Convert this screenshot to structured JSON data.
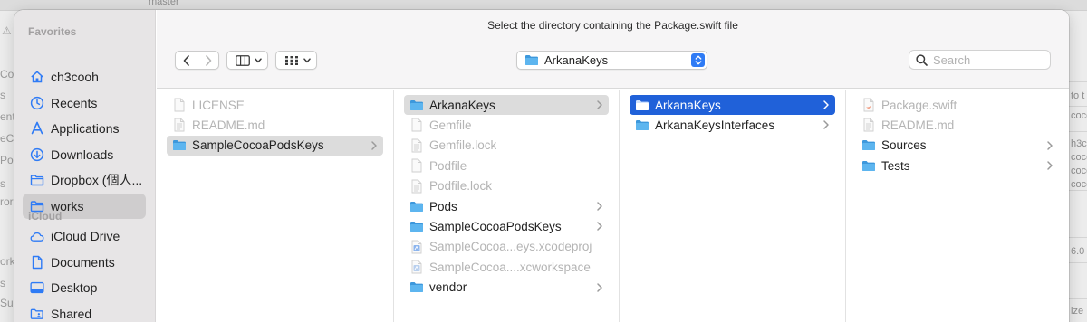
{
  "background": {
    "branch": "master",
    "left_fragments": [
      "Coc",
      "s",
      "entV",
      "eCo",
      "Po",
      "s",
      "rork",
      "ork",
      "s",
      "Sup"
    ],
    "right_fragments": [
      "to t",
      "coco",
      "h3co",
      "coco",
      "coco",
      "coco",
      "6.0",
      "ize"
    ]
  },
  "dialog": {
    "title": "Select the directory containing the Package.swift file",
    "current_directory": "ArkanaKeys",
    "search_placeholder": "Search"
  },
  "sidebar": {
    "favorites_title": "Favorites",
    "favorites": [
      {
        "label": "ch3cooh",
        "icon": "home-icon"
      },
      {
        "label": "Recents",
        "icon": "clock-icon"
      },
      {
        "label": "Applications",
        "icon": "applications-icon"
      },
      {
        "label": "Downloads",
        "icon": "download-icon"
      },
      {
        "label": "Dropbox (個人...",
        "icon": "folder-icon"
      },
      {
        "label": "works",
        "icon": "folder-icon",
        "selected": true
      }
    ],
    "icloud_title": "iCloud",
    "icloud": [
      {
        "label": "iCloud Drive",
        "icon": "cloud-icon"
      },
      {
        "label": "Documents",
        "icon": "document-icon"
      },
      {
        "label": "Desktop",
        "icon": "desktop-icon"
      },
      {
        "label": "Shared",
        "icon": "shared-folder-icon"
      }
    ]
  },
  "columns": [
    {
      "items": [
        {
          "label": "LICENSE",
          "type": "file",
          "dim": true
        },
        {
          "label": "README.md",
          "type": "doc",
          "dim": true
        },
        {
          "label": "SampleCocoaPodsKeys",
          "type": "folder",
          "state": "selected-gray",
          "chevron": true
        }
      ]
    },
    {
      "items": [
        {
          "label": "ArkanaKeys",
          "type": "folder",
          "state": "selected-gray",
          "chevron": true
        },
        {
          "label": "Gemfile",
          "type": "file",
          "dim": true
        },
        {
          "label": "Gemfile.lock",
          "type": "doc",
          "dim": true
        },
        {
          "label": "Podfile",
          "type": "file",
          "dim": true
        },
        {
          "label": "Podfile.lock",
          "type": "doc",
          "dim": true
        },
        {
          "label": "Pods",
          "type": "folder",
          "chevron": true
        },
        {
          "label": "SampleCocoaPodsKeys",
          "type": "folder",
          "chevron": true
        },
        {
          "label": "SampleCocoa...eys.xcodeproj",
          "type": "xcodeproj",
          "dim": true
        },
        {
          "label": "SampleCocoa....xcworkspace",
          "type": "xcworkspace",
          "dim": true
        },
        {
          "label": "vendor",
          "type": "folder",
          "chevron": true
        }
      ]
    },
    {
      "items": [
        {
          "label": "ArkanaKeys",
          "type": "folder",
          "state": "selected-blue",
          "chevron": true
        },
        {
          "label": "ArkanaKeysInterfaces",
          "type": "folder",
          "chevron": true
        }
      ]
    },
    {
      "items": [
        {
          "label": "Package.swift",
          "type": "swift",
          "dim": true
        },
        {
          "label": "README.md",
          "type": "doc",
          "dim": true
        },
        {
          "label": "Sources",
          "type": "folder",
          "chevron": true
        },
        {
          "label": "Tests",
          "type": "folder",
          "chevron": true
        }
      ]
    }
  ],
  "colors": {
    "accent": "#2061d9",
    "folder": "#4aa7e6",
    "sidebar_icon": "#2f7bf5",
    "selection_gray": "#dcdcdc"
  }
}
